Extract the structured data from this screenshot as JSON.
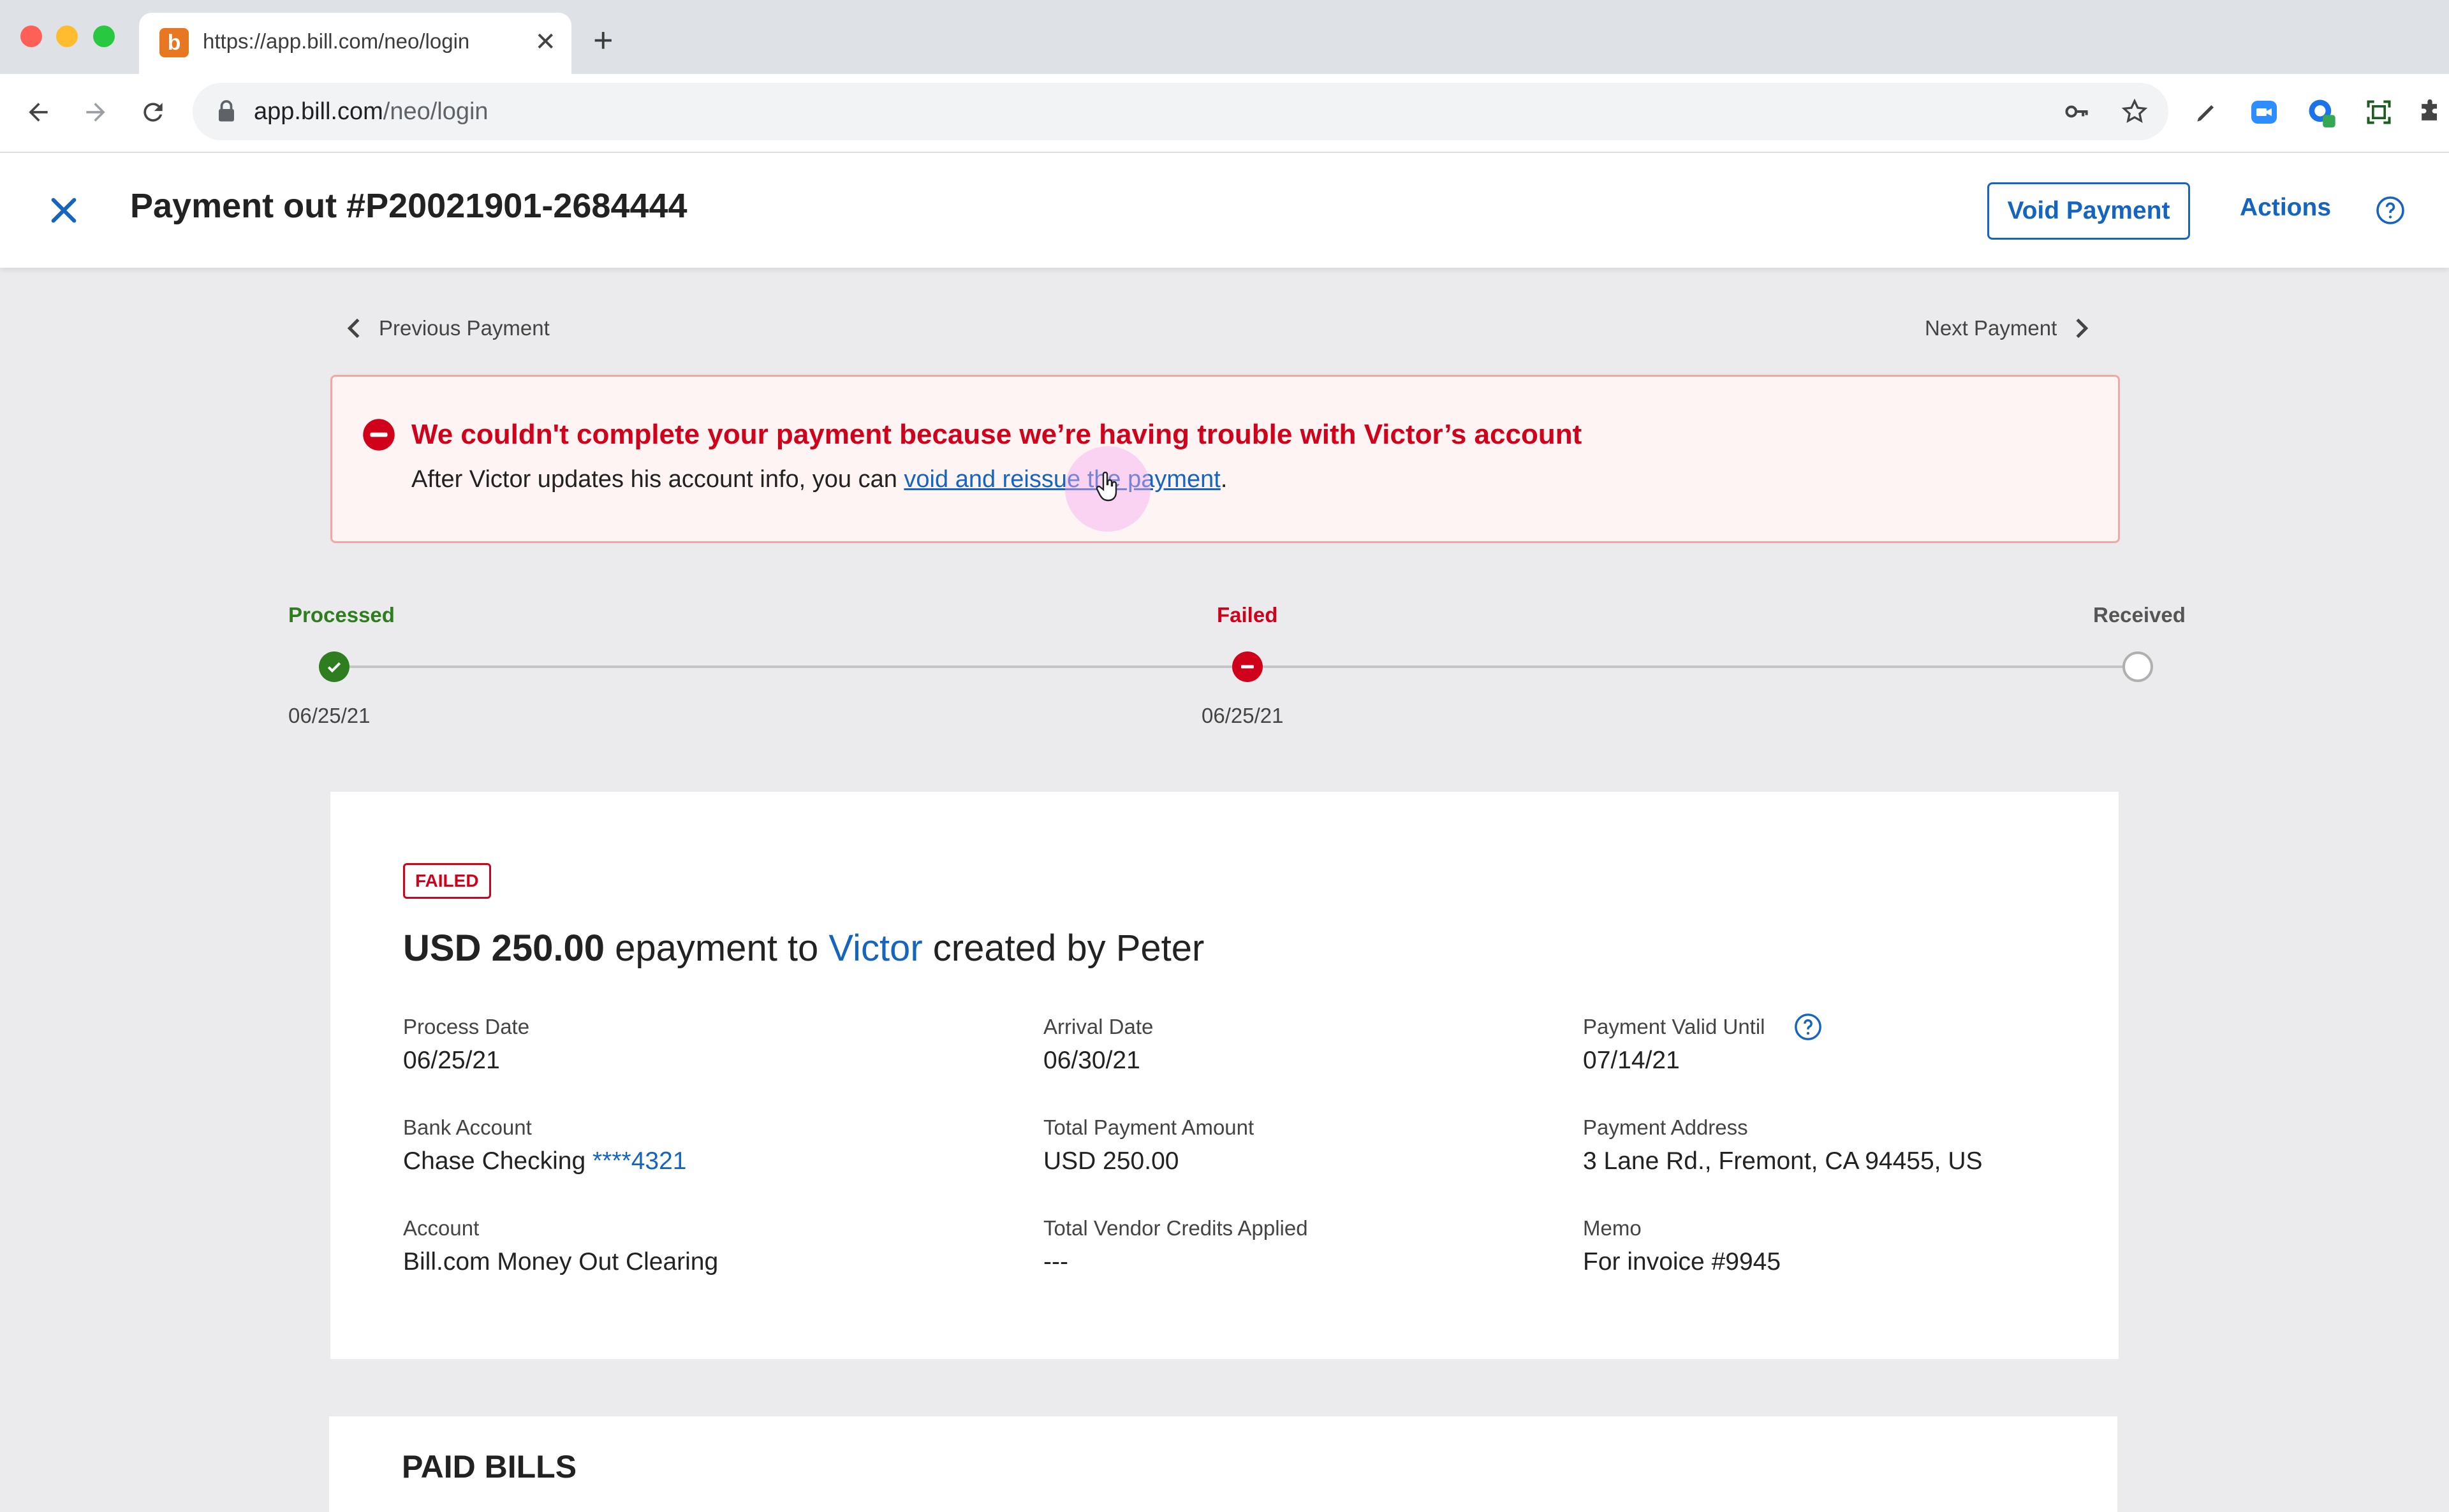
{
  "browser": {
    "tab_title": "https://app.bill.com/neo/login",
    "tab_favicon_letter": "b",
    "url_host": "app.bill.com",
    "url_path": "/neo/login"
  },
  "header": {
    "title": "Payment out #P20021901-2684444",
    "void_label": "Void Payment",
    "actions_label": "Actions"
  },
  "pager": {
    "prev_label": "Previous Payment",
    "next_label": "Next Payment"
  },
  "alert": {
    "title": "We couldn't complete your payment because we’re having trouble with Victor’s account",
    "body_prefix": "After Victor updates his account info, you can ",
    "link_text": "void and reissue the payment",
    "body_suffix": "."
  },
  "timeline": {
    "steps": [
      {
        "label": "Processed",
        "date": "06/25/21",
        "state": "complete",
        "color": "#2e7d1e"
      },
      {
        "label": "Failed",
        "date": "06/25/21",
        "state": "failed",
        "color": "#d0021b"
      },
      {
        "label": "Received",
        "date": "",
        "state": "pending",
        "color": "#555555"
      }
    ]
  },
  "payment": {
    "status": "FAILED",
    "amount": "USD 250.00",
    "summary_mid": " epayment to ",
    "vendor": "Victor",
    "summary_end": " created by Peter",
    "fields": {
      "process_date": {
        "label": "Process Date",
        "value": "06/25/21"
      },
      "arrival_date": {
        "label": "Arrival Date",
        "value": "06/30/21"
      },
      "valid_until": {
        "label": "Payment Valid Until",
        "value": "07/14/21"
      },
      "bank_account": {
        "label": "Bank Account",
        "value_prefix": "Chase Checking ",
        "value_link": "****4321"
      },
      "total_amount": {
        "label": "Total Payment Amount",
        "value": "USD 250.00"
      },
      "payment_address": {
        "label": "Payment Address",
        "value": "3 Lane Rd., Fremont, CA 94455, US"
      },
      "account": {
        "label": "Account",
        "value": "Bill.com Money Out Clearing"
      },
      "vendor_credits": {
        "label": "Total Vendor Credits Applied",
        "value": "---"
      },
      "memo": {
        "label": "Memo",
        "value": "For invoice #9945"
      }
    }
  },
  "paid_bills": {
    "title": "PAID BILLS"
  },
  "colors": {
    "brand_blue": "#1565c0",
    "error_red": "#d0021b",
    "success_green": "#2e7d1e"
  }
}
